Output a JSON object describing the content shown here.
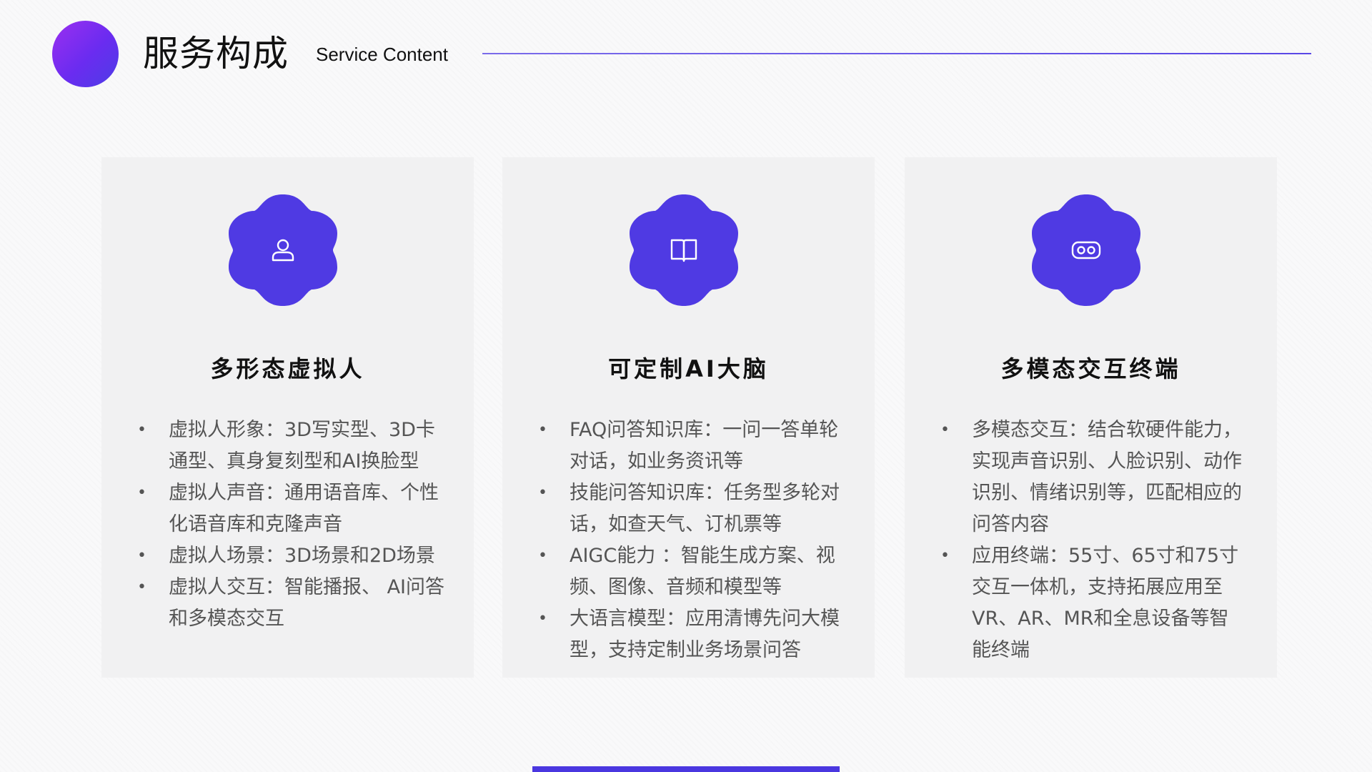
{
  "header": {
    "title": "服务构成",
    "subtitle": "Service Content"
  },
  "colors": {
    "accent": "#4f3ae3",
    "circle_gradient_start": "#9b2ff0",
    "circle_gradient_end": "#4d3de6",
    "card_background": "#f1f1f2"
  },
  "cards": [
    {
      "icon": "user-icon",
      "title": "多形态虚拟人",
      "items": [
        "虚拟人形象：3D写实型、3D卡通型、真身复刻型和AI换脸型",
        "虚拟人声音：通用语音库、个性化语音库和克隆声音",
        "虚拟人场景：3D场景和2D场景",
        "虚拟人交互：智能播报、 AI问答和多模态交互"
      ]
    },
    {
      "icon": "book-icon",
      "title": "可定制AI大脑",
      "items": [
        "FAQ问答知识库：一问一答单轮对话，如业务资讯等",
        "技能问答知识库：任务型多轮对话，如查天气、订机票等",
        "AIGC能力 ：智能生成方案、视频、图像、音频和模型等",
        "大语言模型：应用清博先问大模型，支持定制业务场景问答"
      ]
    },
    {
      "icon": "vr-headset-icon",
      "title": "多模态交互终端",
      "items": [
        "多模态交互：结合软硬件能力，实现声音识别、人脸识别、动作识别、情绪识别等，匹配相应的问答内容",
        "应用终端：55寸、65寸和75寸交互一体机，支持拓展应用至VR、AR、MR和全息设备等智能终端"
      ]
    }
  ]
}
